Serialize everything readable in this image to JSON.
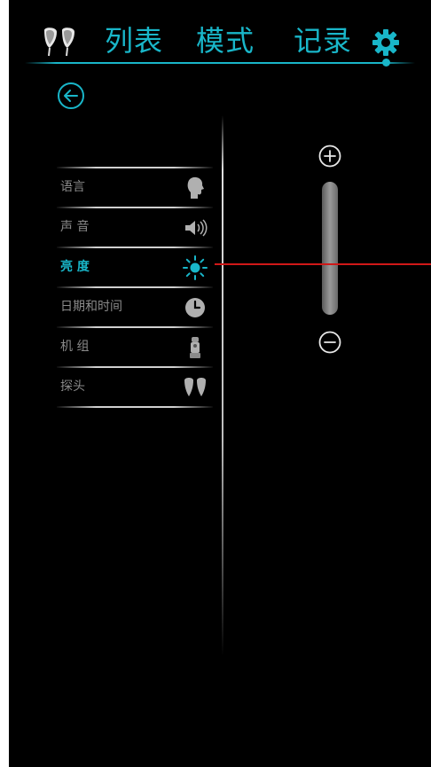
{
  "topbar": {
    "tabs": [
      "列表",
      "模式",
      "记录"
    ],
    "logo_icon": "earphones-icon",
    "settings_icon": "gear-icon",
    "accent_color": "#19b6c9"
  },
  "nav": {
    "back_icon": "arrow-left-circle-icon"
  },
  "settings_menu": {
    "items": [
      {
        "label": "语言",
        "icon": "head-profile-icon",
        "active": false
      },
      {
        "label": "声 音",
        "icon": "speaker-icon",
        "active": false
      },
      {
        "label": "亮 度",
        "icon": "sun-icon",
        "active": true
      },
      {
        "label": "日期和时间",
        "icon": "clock-icon",
        "active": false
      },
      {
        "label": "机 组",
        "icon": "device-unit-icon",
        "active": false
      },
      {
        "label": "探头",
        "icon": "earpiece-probe-icon",
        "active": false
      }
    ]
  },
  "brightness": {
    "increase_icon": "plus-circle-icon",
    "decrease_icon": "minus-circle-icon",
    "indicator_color": "#d01818"
  }
}
